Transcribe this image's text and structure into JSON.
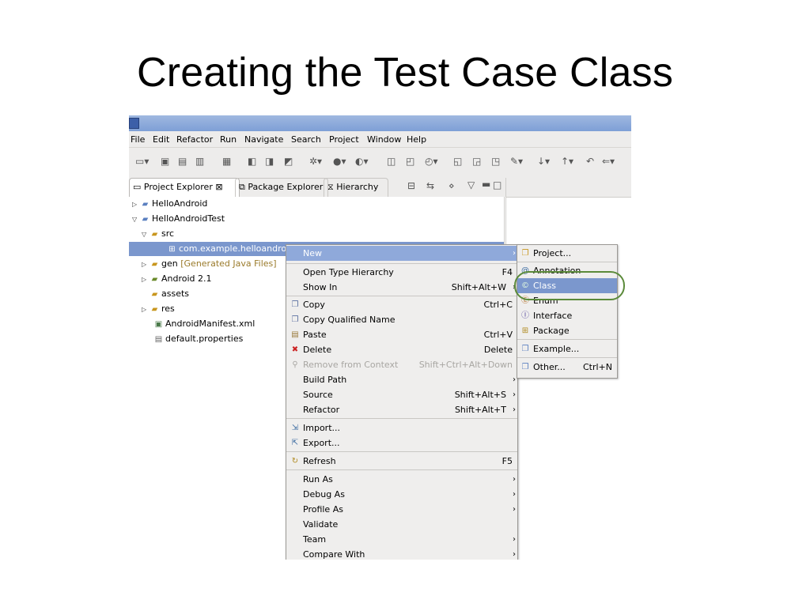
{
  "slide": {
    "title": "Creating the Test Case Class"
  },
  "menubar": [
    "File",
    "Edit",
    "Refactor",
    "Run",
    "Navigate",
    "Search",
    "Project",
    "Window",
    "Help"
  ],
  "tabs": [
    {
      "label": "Project Explorer",
      "close": "⊠",
      "active": true
    },
    {
      "label": "Package Explorer",
      "active": false
    },
    {
      "label": "Hierarchy",
      "active": false
    }
  ],
  "tree": [
    {
      "label": "HelloAndroid",
      "twisty": "▷",
      "indent": 0,
      "icon": "project-icon"
    },
    {
      "label": "HelloAndroidTest",
      "twisty": "▽",
      "indent": 0,
      "icon": "project-icon"
    },
    {
      "label": "src",
      "twisty": "▽",
      "indent": 1,
      "icon": "source-folder-icon"
    },
    {
      "label": "com.example.helloandroid",
      "twisty": "",
      "indent": 3,
      "icon": "package-icon",
      "selected": true
    },
    {
      "label": "gen",
      "suffix": "[Generated Java Files]",
      "twisty": "▷",
      "indent": 1,
      "icon": "source-folder-icon"
    },
    {
      "label": "Android 2.1",
      "twisty": "▷",
      "indent": 1,
      "icon": "library-icon"
    },
    {
      "label": "assets",
      "twisty": "",
      "indent": 2,
      "icon": "folder-icon"
    },
    {
      "label": "res",
      "twisty": "▷",
      "indent": 1,
      "icon": "folder-icon"
    },
    {
      "label": "AndroidManifest.xml",
      "twisty": "",
      "indent": 2,
      "icon": "xml-file-icon"
    },
    {
      "label": "default.properties",
      "twisty": "",
      "indent": 2,
      "icon": "file-icon"
    }
  ],
  "context_menu": [
    {
      "label": "New",
      "shortcut": "",
      "submenu": true,
      "highlighted": true
    },
    {
      "sep": true
    },
    {
      "label": "Open Type Hierarchy",
      "shortcut": "F4"
    },
    {
      "label": "Show In",
      "shortcut": "Shift+Alt+W",
      "submenu": true
    },
    {
      "sep": true
    },
    {
      "label": "Copy",
      "shortcut": "Ctrl+C",
      "icon": "copy-icon"
    },
    {
      "label": "Copy Qualified Name",
      "shortcut": "",
      "icon": "copy-qualified-icon"
    },
    {
      "label": "Paste",
      "shortcut": "Ctrl+V",
      "icon": "paste-icon"
    },
    {
      "label": "Delete",
      "shortcut": "Delete",
      "icon": "delete-icon"
    },
    {
      "label": "Remove from Context",
      "shortcut": "Shift+Ctrl+Alt+Down",
      "disabled": true,
      "icon": "remove-context-icon"
    },
    {
      "label": "Build Path",
      "shortcut": "",
      "submenu": true
    },
    {
      "label": "Source",
      "shortcut": "Shift+Alt+S",
      "submenu": true
    },
    {
      "label": "Refactor",
      "shortcut": "Shift+Alt+T",
      "submenu": true
    },
    {
      "sep": true
    },
    {
      "label": "Import...",
      "shortcut": "",
      "icon": "import-icon"
    },
    {
      "label": "Export...",
      "shortcut": "",
      "icon": "export-icon"
    },
    {
      "sep": true
    },
    {
      "label": "Refresh",
      "shortcut": "F5",
      "icon": "refresh-icon"
    },
    {
      "sep": true
    },
    {
      "label": "Run As",
      "shortcut": "",
      "submenu": true
    },
    {
      "label": "Debug As",
      "shortcut": "",
      "submenu": true
    },
    {
      "label": "Profile As",
      "shortcut": "",
      "submenu": true
    },
    {
      "label": "Validate",
      "shortcut": ""
    },
    {
      "label": "Team",
      "shortcut": "",
      "submenu": true
    },
    {
      "label": "Compare With",
      "shortcut": "",
      "submenu": true
    }
  ],
  "submenu": [
    {
      "label": "Project...",
      "shortcut": "",
      "icon": "new-project-icon"
    },
    {
      "sep": true
    },
    {
      "label": "Annotation",
      "shortcut": "",
      "icon": "annotation-icon"
    },
    {
      "label": "Class",
      "shortcut": "",
      "icon": "class-icon",
      "highlighted": true
    },
    {
      "label": "Enum",
      "shortcut": "",
      "icon": "enum-icon"
    },
    {
      "label": "Interface",
      "shortcut": "",
      "icon": "interface-icon"
    },
    {
      "label": "Package",
      "shortcut": "",
      "icon": "package-icon"
    },
    {
      "sep": true
    },
    {
      "label": "Example...",
      "shortcut": "",
      "icon": "example-icon"
    },
    {
      "sep": true
    },
    {
      "label": "Other...",
      "shortcut": "Ctrl+N",
      "icon": "other-icon"
    }
  ],
  "colors": {
    "selection": "#7b97cd",
    "highlight_ring": "#5b8a3a",
    "titlebar": "#8aa8db"
  }
}
